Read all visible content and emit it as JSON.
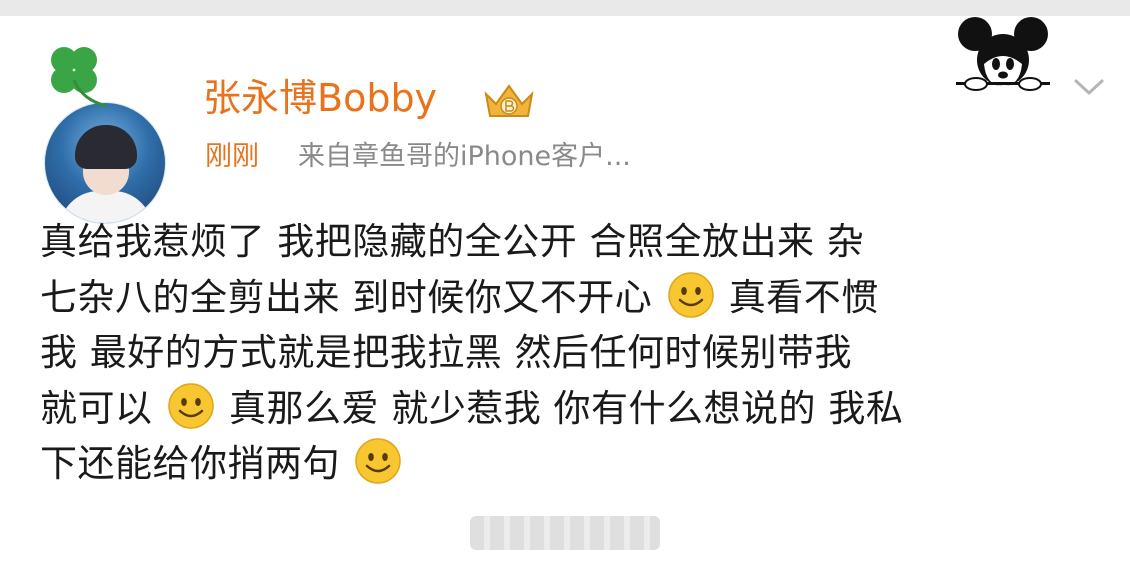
{
  "post": {
    "username": "张永博Bobby",
    "time": "刚刚",
    "source": "来自章鱼哥的iPhone客户...",
    "body_lines": [
      [
        "真给我惹烦了 我把隐藏的全公开 合照全放出来 杂"
      ],
      [
        "七杂八的全剪出来 到时候你又不开心",
        "smile-emoji",
        "真看不惯"
      ],
      [
        "我 最好的方式就是把我拉黑 然后任何时候别带我"
      ],
      [
        "就可以",
        "smile-emoji",
        "真那么爱 就少惹我 你有什么想说的 我私"
      ],
      [
        "下还能给你捎两句",
        "smile-emoji"
      ]
    ]
  },
  "icons": {
    "avatar_decoration": "four-leaf-clover-icon",
    "badge": "crown-badge-icon",
    "sticker": "mickey-mouse-icon",
    "menu": "chevron-down-icon",
    "emoji": "smile-emoji"
  },
  "colors": {
    "username": "#e8731c",
    "time": "#e8731c",
    "source": "#8a8a8a",
    "body_text": "#1a1a1a"
  }
}
